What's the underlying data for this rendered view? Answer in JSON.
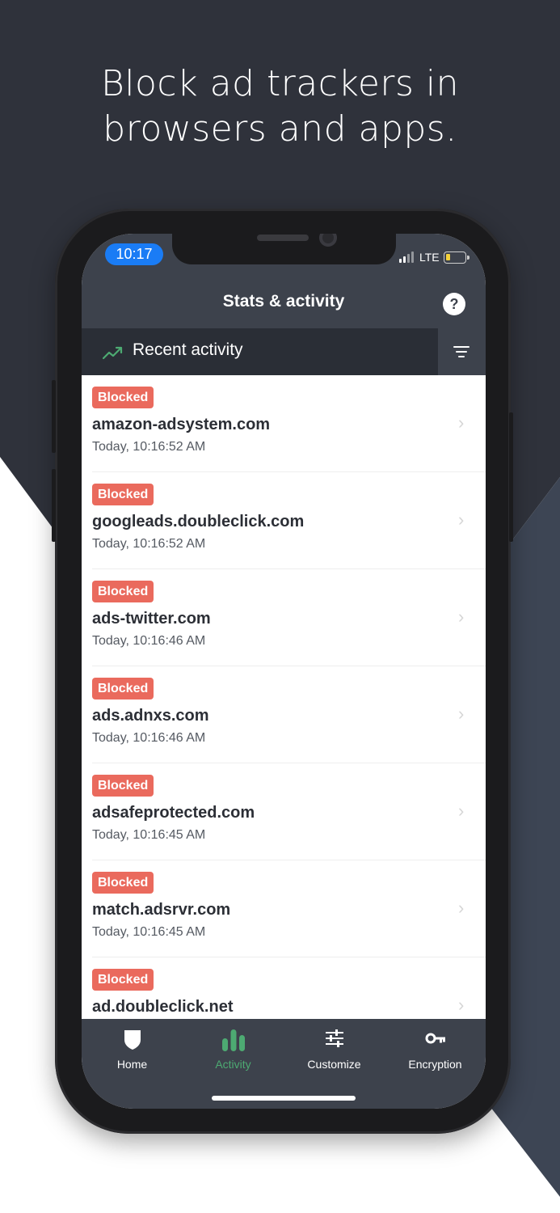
{
  "headline": {
    "line1": "Block ad trackers in",
    "line2": "browsers and apps."
  },
  "status_bar": {
    "time": "10:17",
    "network": "LTE"
  },
  "nav": {
    "title": "Stats & activity",
    "help_icon_label": "?"
  },
  "section": {
    "title": "Recent activity",
    "icon": "trend-line-icon",
    "filter_icon": "filter-icon"
  },
  "activity": [
    {
      "status": "Blocked",
      "domain": "amazon-adsystem.com",
      "time": "Today, 10:16:52 AM"
    },
    {
      "status": "Blocked",
      "domain": "googleads.doubleclick.com",
      "time": "Today, 10:16:52 AM"
    },
    {
      "status": "Blocked",
      "domain": "ads-twitter.com",
      "time": "Today, 10:16:46 AM"
    },
    {
      "status": "Blocked",
      "domain": "ads.adnxs.com",
      "time": "Today, 10:16:46 AM"
    },
    {
      "status": "Blocked",
      "domain": "adsafeprotected.com",
      "time": "Today, 10:16:45 AM"
    },
    {
      "status": "Blocked",
      "domain": "match.adsrvr.com",
      "time": "Today, 10:16:45 AM"
    },
    {
      "status": "Blocked",
      "domain": "ad.doubleclick.net",
      "time": ""
    }
  ],
  "tabs": [
    {
      "label": "Home",
      "icon": "shield-icon",
      "active": false
    },
    {
      "label": "Activity",
      "icon": "bar-chart-icon",
      "active": true
    },
    {
      "label": "Customize",
      "icon": "sliders-icon",
      "active": false
    },
    {
      "label": "Encryption",
      "icon": "key-icon",
      "active": false
    }
  ],
  "colors": {
    "background_dark": "#2f323b",
    "background_slate": "#3d4554",
    "bar": "#3d424c",
    "section_bar": "#2a2e36",
    "badge": "#ea6a5d",
    "accent_green": "#4daa72",
    "time_pill": "#1a7cf5"
  }
}
